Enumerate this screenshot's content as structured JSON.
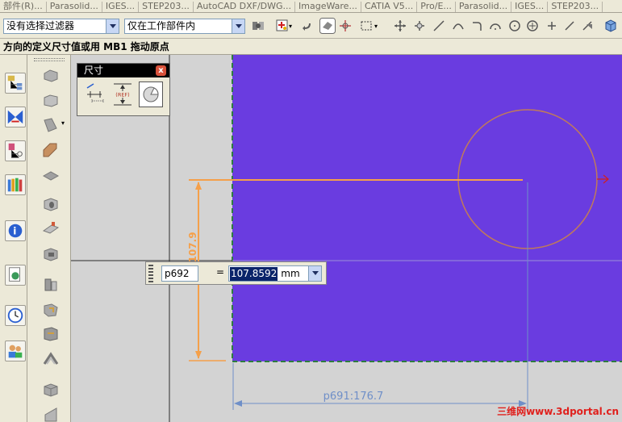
{
  "tabstrip": {
    "tabs": [
      "部件(R)...",
      "Parasolid...",
      "IGES...",
      "STEP203...",
      "AutoCAD DXF/DWG...",
      "ImageWare...",
      "CATIA V5...",
      "Pro/E...",
      "Parasolid...",
      "IGES...",
      "STEP203..."
    ]
  },
  "toolbar": {
    "filter_value": "没有选择过滤器",
    "scope_value": "仅在工作部件内"
  },
  "status": {
    "prompt": "方向的定义尺寸值或用 MB1 拖动原点"
  },
  "dim_palette": {
    "title": "尺寸",
    "close_label": "x",
    "ref_label": "(REF)"
  },
  "value_entry": {
    "name": "p692",
    "equals": "=",
    "value": "107.8592",
    "unit": "mm"
  },
  "canvas": {
    "vertical_dim_label": "2:107.9",
    "horizontal_dim_label": "p691:176.7",
    "watermark": "三维网www.3dportal.cn"
  },
  "colors": {
    "sheet": "#6a3ce0",
    "dimension_orange": "#f5a04a",
    "dimension_blue": "#6f8fc8",
    "circle": "#c07a5a",
    "watermark": "#e0201c"
  }
}
